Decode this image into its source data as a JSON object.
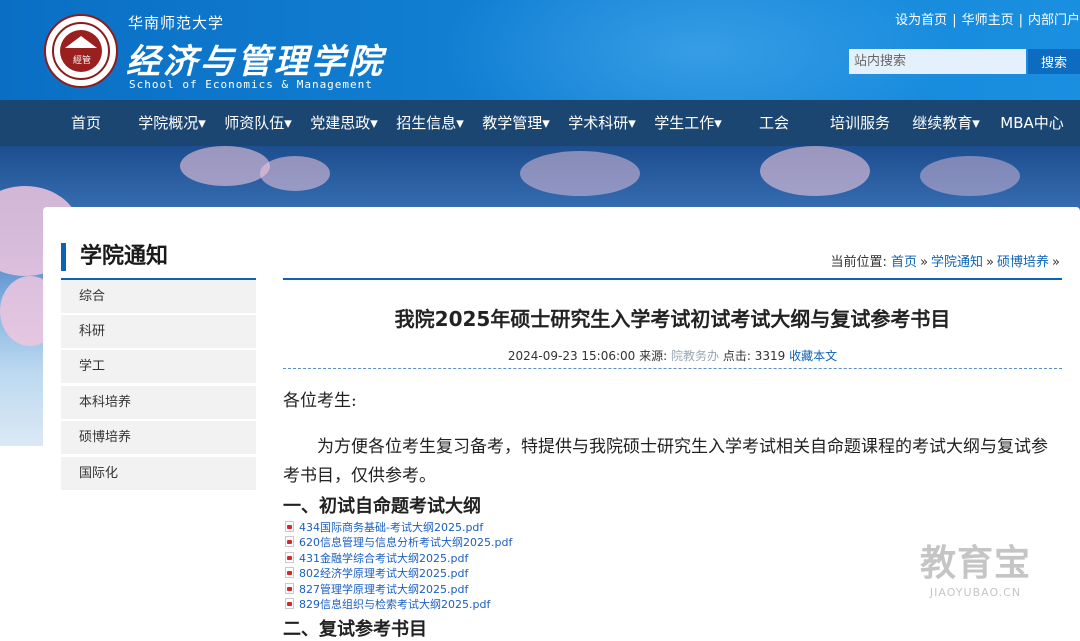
{
  "header": {
    "university": "华南师范大学",
    "school_cn": "经济与管理学院",
    "school_en": "School of Economics & Management",
    "seal_text": "經管",
    "top_links": [
      "设为首页",
      "华师主页",
      "内部门户"
    ],
    "top_sep": "|",
    "search_placeholder": "站内搜索",
    "search_button": "搜索"
  },
  "nav": {
    "items": [
      "首页",
      "学院概况",
      "师资队伍",
      "党建思政",
      "招生信息",
      "教学管理",
      "学术科研",
      "学生工作",
      "工会",
      "培训服务",
      "继续教育",
      "MBA中心"
    ],
    "has_dropdown": [
      false,
      true,
      true,
      true,
      true,
      true,
      true,
      true,
      false,
      false,
      true,
      false
    ]
  },
  "sidebar": {
    "title": "学院通知",
    "items": [
      "综合",
      "科研",
      "学工",
      "本科培养",
      "硕博培养",
      "国际化"
    ]
  },
  "breadcrumb": {
    "prefix": "当前位置:",
    "items": [
      "首页",
      "学院通知",
      "硕博培养"
    ],
    "sep": "»"
  },
  "article": {
    "title": "我院2025年硕士研究生入学考试初试考试大纲与复试参考书目",
    "date": "2024-09-23 15:06:00",
    "source_label": "来源:",
    "source": "院教务办",
    "clicks_label": "点击:",
    "clicks": "3319",
    "favorite": "收藏本文",
    "greeting": "各位考生:",
    "paragraph": "为方便各位考生复习备考，特提供与我院硕士研究生入学考试相关自命题课程的考试大纲与复试参考书目，仅供参考。",
    "section1": "一、初试自命题考试大纲",
    "files": [
      "434国际商务基础-考试大纲2025.pdf",
      "620信息管理与信息分析考试大纲2025.pdf",
      "431金融学综合考试大纲2025.pdf",
      "802经济学原理考试大纲2025.pdf",
      "827管理学原理考试大纲2025.pdf",
      "829信息组织与检索考试大纲2025.pdf"
    ],
    "section2": "二、复试参考书目"
  },
  "watermark": {
    "text": "教育宝",
    "url": "JIAOYUBAO.CN"
  },
  "colors": {
    "header_blue": "#1383d6",
    "nav_bg": "#1c4672",
    "accent": "#0b63b7",
    "sidebar_bg": "#f2f2f2"
  }
}
